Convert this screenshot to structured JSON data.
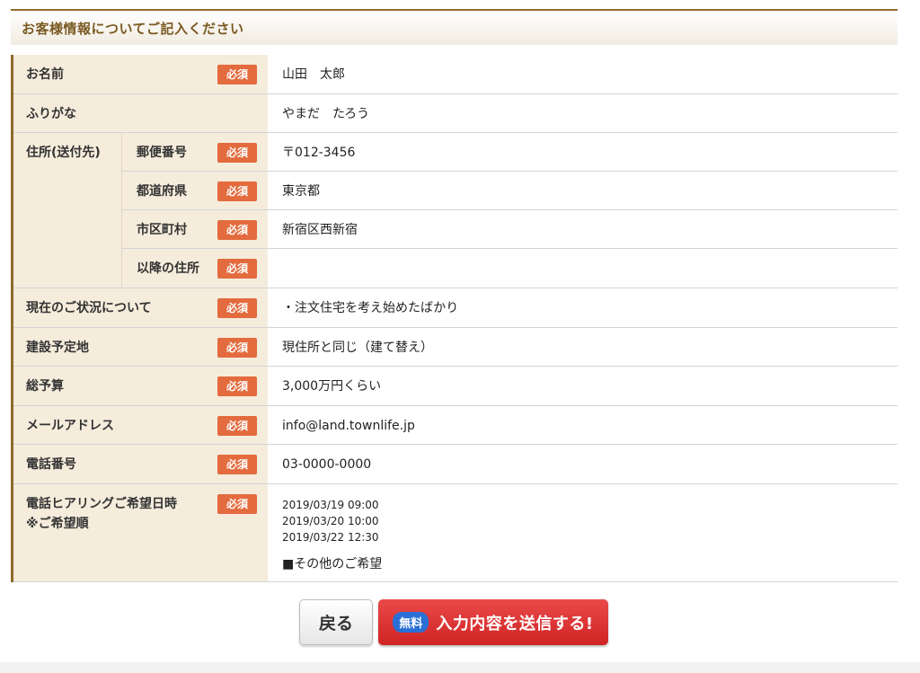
{
  "section_title": "お客様情報についてご記入ください",
  "required_badge": "必須",
  "fields": {
    "name": {
      "label": "お名前",
      "value": "山田　太郎"
    },
    "furigana": {
      "label": "ふりがな",
      "value": "やまだ　たろう"
    },
    "address": {
      "label": "住所(送付先)",
      "postal": {
        "label": "郵便番号",
        "value": "〒012-3456"
      },
      "prefecture": {
        "label": "都道府県",
        "value": "東京都"
      },
      "city": {
        "label": "市区町村",
        "value": "新宿区西新宿"
      },
      "rest": {
        "label": "以降の住所",
        "value": ""
      }
    },
    "status": {
      "label": "現在のご状況について",
      "value": "・注文住宅を考え始めたばかり"
    },
    "site": {
      "label": "建設予定地",
      "value": "現住所と同じ（建て替え）"
    },
    "budget": {
      "label": "総予算",
      "value": "3,000万円くらい"
    },
    "email": {
      "label": "メールアドレス",
      "value": "info@land.townlife.jp"
    },
    "phone": {
      "label": "電話番号",
      "value": "03-0000-0000"
    },
    "hearing": {
      "label_line1": "電話ヒアリングご希望日時",
      "label_line2": "※ご希望順",
      "dates": [
        "2019/03/19 09:00",
        "2019/03/20 10:00",
        "2019/03/22 12:30"
      ],
      "other": "■その他のご希望"
    }
  },
  "buttons": {
    "back": "戻る",
    "free_tag": "無料",
    "submit": "入力内容を送信する!"
  },
  "colors": {
    "accent_brown": "#8e6b2a",
    "label_bg": "#f5ecdc",
    "badge": "#e36b3e",
    "submit_red": "#d82b2b",
    "free_blue": "#2a6fd6"
  }
}
